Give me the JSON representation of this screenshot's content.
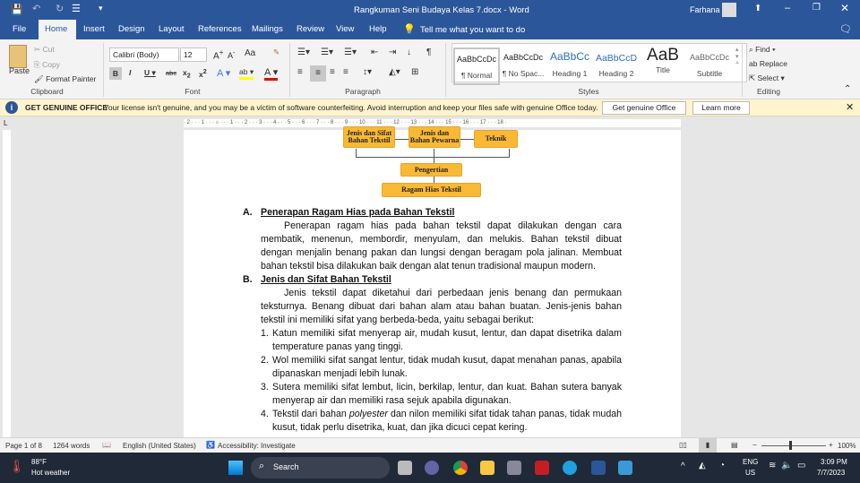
{
  "window": {
    "title": "Rangkuman Seni Budaya Kelas 7.docx  -  Word",
    "user": "Farhana"
  },
  "tabs": [
    "File",
    "Home",
    "Insert",
    "Design",
    "Layout",
    "References",
    "Mailings",
    "Review",
    "View",
    "Help"
  ],
  "tell_me": "Tell me what you want to do",
  "clipboard": {
    "paste": "Paste",
    "cut": "Cut",
    "copy": "Copy",
    "format_painter": "Format Painter",
    "label": "Clipboard"
  },
  "font": {
    "name": "Calibri (Body)",
    "size": "12",
    "label": "Font",
    "case": "Aa"
  },
  "paragraph": {
    "label": "Paragraph"
  },
  "styles": {
    "label": "Styles",
    "items": [
      {
        "preview": "AaBbCcDc",
        "name": "¶ Normal"
      },
      {
        "preview": "AaBbCcDc",
        "name": "¶ No Spac..."
      },
      {
        "preview": "AaBbCc",
        "name": "Heading 1"
      },
      {
        "preview": "AaBbCcD",
        "name": "Heading 2"
      },
      {
        "preview": "AaB",
        "name": "Title"
      },
      {
        "preview": "AaBbCcDc",
        "name": "Subtitle"
      }
    ]
  },
  "editing": {
    "find": "Find",
    "replace": "Replace",
    "select": "Select",
    "label": "Editing"
  },
  "message": {
    "title": "GET GENUINE OFFICE",
    "text": "Your license isn't genuine, and you may be a victim of software counterfeiting. Avoid interruption and keep your files safe with genuine Office today.",
    "button1": "Get genuine Office",
    "button2": "Learn more"
  },
  "ruler": "· 2 · · · 1 · · · ⌂ · · · 1 · · · 2 · · · 3 · · · 4 · · · 5 · · · 6 · · · 7 · · · 8 · · · 9 · · · 10 · · · 11 · · · 12 · · · 13 · · · 14 · · · 15 · · · 16 · · · 17 · · · 18 ·",
  "diagram": {
    "box1": "Jenis dan Sifat Bahan Tekstil",
    "box2": "Jenis dan Bahan Pewarna",
    "box3": "Teknik",
    "mid": "Pengertian",
    "root": "Ragam Hias Tekstil"
  },
  "document": {
    "secA": {
      "marker": "A.",
      "title": "Penerapan Ragam Hias pada Bahan Tekstil",
      "body": "Penerapan ragam hias pada bahan tekstil dapat dilakukan dengan cara membatik, menenun, membordir, menyulam, dan melukis. Bahan tekstil dibuat dengan menjalin benang pakan dan lungsi dengan beragam pola jalinan. Membuat bahan tekstil bisa dilakukan baik dengan alat tenun tradisional maupun modern."
    },
    "secB": {
      "marker": "B.",
      "title": "Jenis dan Sifat Bahan Tekstil",
      "body": "Jenis tekstil dapat diketahui dari perbedaan jenis benang dan permukaan teksturnya. Benang dibuat dari bahan alam atau bahan buatan. Jenis-jenis bahan tekstil ini memiliki sifat yang berbeda-beda, yaitu sebagai berikut:"
    },
    "list": [
      {
        "n": "1.",
        "text": "Katun memiliki sifat menyerap air, mudah kusut, lentur, dan dapat disetrika dalam temperature panas yang tinggi."
      },
      {
        "n": "2.",
        "text": "Wol memiliki sifat sangat lentur, tidak mudah kusut, dapat menahan panas, apabila dipanaskan menjadi lebih lunak."
      },
      {
        "n": "3.",
        "text": "Sutera memiliki sifat lembut, licin, berkilap, lentur, dan kuat. Bahan sutera banyak menyerap air dan memiliki rasa sejuk apabila digunakan."
      },
      {
        "n": "4.",
        "pre": "Tekstil dari bahan ",
        "em": "polyester",
        "post": " dan nilon memiliki sifat tidak tahan panas, tidak mudah kusut, tidak perlu disetrika, kuat, dan jika dicuci cepat kering."
      }
    ]
  },
  "status": {
    "page": "Page 1 of 8",
    "words": "1264 words",
    "language": "English (United States)",
    "accessibility": "Accessibility: Investigate",
    "zoom": "100%",
    "zoom_value": 100
  },
  "taskbar": {
    "temp": "88°F",
    "weather": "Hot weather",
    "search": "Search",
    "lang1": "ENG",
    "lang2": "US",
    "time": "3:09 PM",
    "date": "7/7/2023"
  }
}
